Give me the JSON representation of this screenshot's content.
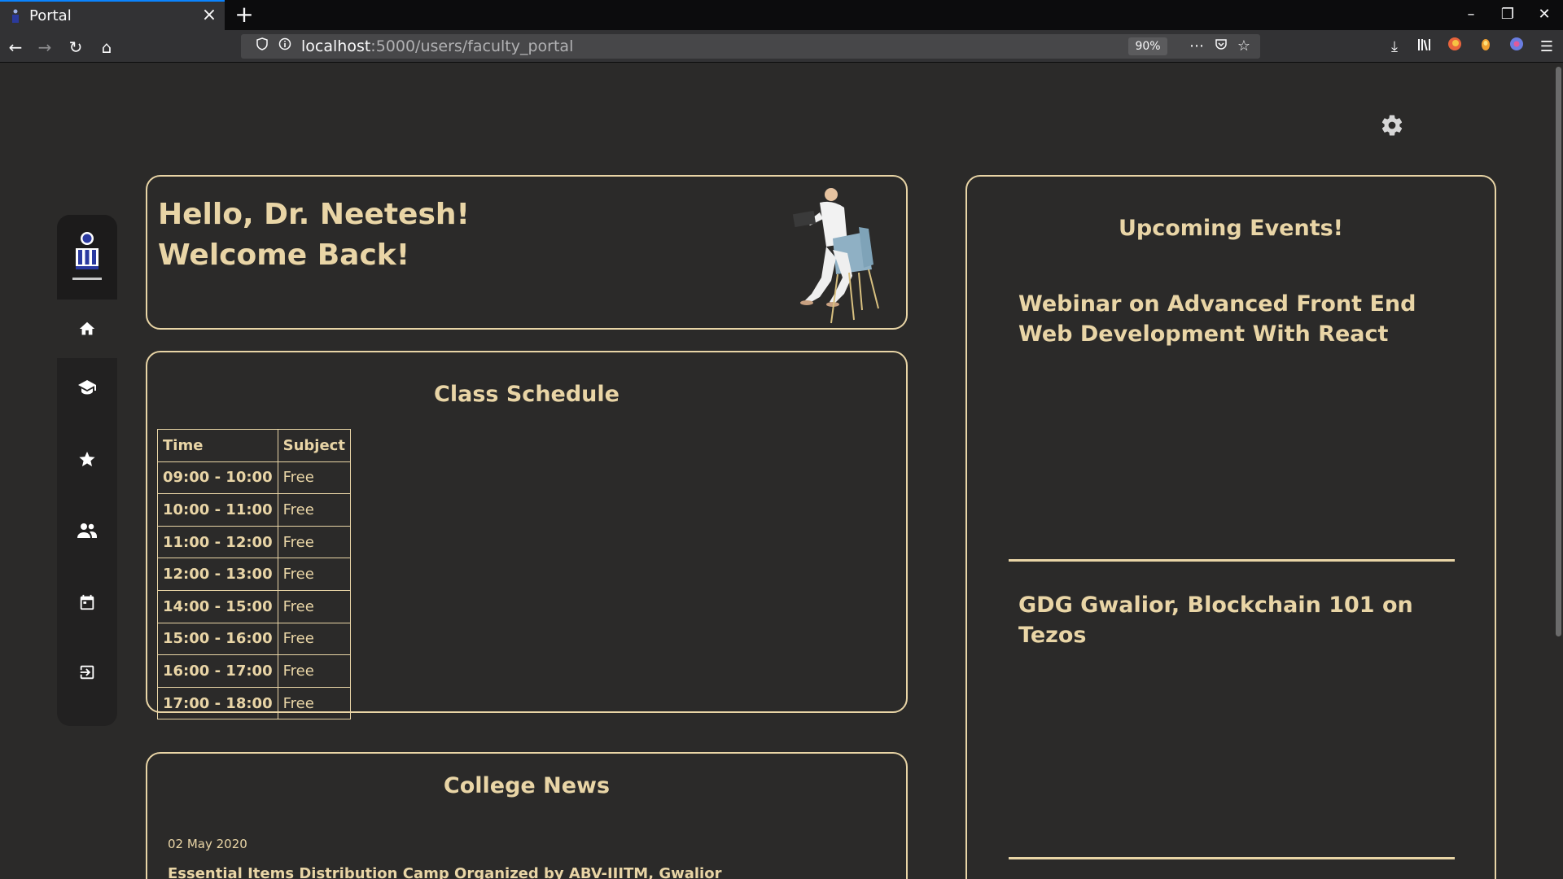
{
  "browser": {
    "tab_title": "Portal",
    "new_tab": "+",
    "url_host": "localhost",
    "url_path": ":5000/users/faculty_portal",
    "zoom": "90%"
  },
  "greeting": {
    "line1": "Hello, Dr. Neetesh!",
    "line2": "Welcome Back!"
  },
  "sidebar": {
    "items": [
      {
        "name": "home-icon"
      },
      {
        "name": "graduation-cap-icon"
      },
      {
        "name": "star-icon"
      },
      {
        "name": "users-icon"
      },
      {
        "name": "calendar-icon"
      },
      {
        "name": "logout-icon"
      }
    ]
  },
  "schedule": {
    "title": "Class Schedule",
    "headers": [
      "Time",
      "Subject"
    ],
    "rows": [
      [
        "09:00 - 10:00",
        "Free"
      ],
      [
        "10:00 - 11:00",
        "Free"
      ],
      [
        "11:00 - 12:00",
        "Free"
      ],
      [
        "12:00 - 13:00",
        "Free"
      ],
      [
        "14:00 - 15:00",
        "Free"
      ],
      [
        "15:00 - 16:00",
        "Free"
      ],
      [
        "16:00 - 17:00",
        "Free"
      ],
      [
        "17:00 - 18:00",
        "Free"
      ]
    ]
  },
  "news": {
    "title": "College News",
    "items": [
      {
        "date": "02 May 2020",
        "headline": "Essential Items Distribution Camp Organized by ABV-IIITM, Gwalior"
      }
    ]
  },
  "events": {
    "title": "Upcoming Events!",
    "items": [
      {
        "title": "Webinar on Advanced Front End Web Development With React"
      },
      {
        "title": "GDG Gwalior, Blockchain 101 on Tezos"
      }
    ]
  },
  "colors": {
    "accent": "#e9d5a6",
    "background": "#2b2a29",
    "sidebar": "#222121"
  }
}
